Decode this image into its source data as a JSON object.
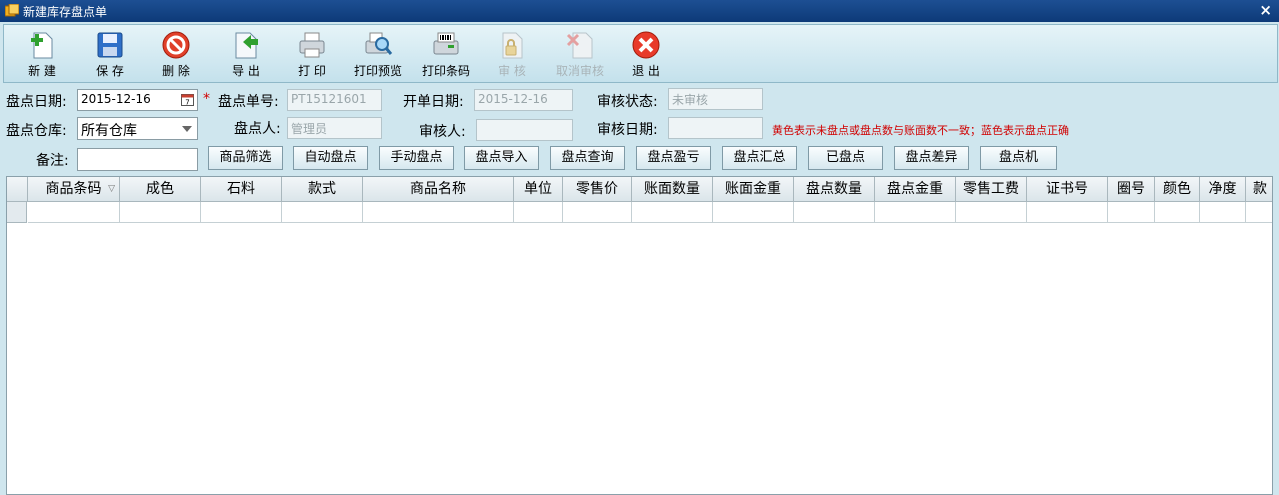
{
  "window": {
    "title": "新建库存盘点单",
    "close": "×"
  },
  "toolbar": [
    {
      "label": "新 建",
      "icon": "new-icon",
      "enabled": true
    },
    {
      "label": "保 存",
      "icon": "save-icon",
      "enabled": true
    },
    {
      "label": "删 除",
      "icon": "delete-icon",
      "enabled": true
    },
    {
      "label": "导 出",
      "icon": "export-icon",
      "enabled": true
    },
    {
      "label": "打 印",
      "icon": "print-icon",
      "enabled": true
    },
    {
      "label": "打印预览",
      "icon": "print-preview-icon",
      "enabled": true
    },
    {
      "label": "打印条码",
      "icon": "print-barcode-icon",
      "enabled": true
    },
    {
      "label": "审 核",
      "icon": "audit-icon",
      "enabled": false
    },
    {
      "label": "取消审核",
      "icon": "cancel-audit-icon",
      "enabled": false
    },
    {
      "label": "退 出",
      "icon": "exit-icon",
      "enabled": true
    }
  ],
  "form": {
    "count_date_label": "盘点日期:",
    "count_date_value": "2015-12-16",
    "required_mark": "*",
    "count_no_label": "盘点单号:",
    "count_no_value": "PT15121601",
    "open_date_label": "开单日期:",
    "open_date_value": "2015-12-16",
    "audit_status_label": "审核状态:",
    "audit_status_value": "未审核",
    "warehouse_label": "盘点仓库:",
    "warehouse_value": "所有仓库",
    "counter_label": "盘点人:",
    "counter_value": "管理员",
    "auditor_label": "审核人:",
    "auditor_value": "",
    "audit_date_label": "审核日期:",
    "audit_date_value": "",
    "hint": "黄色表示未盘点或盘点数与账面数不一致；蓝色表示盘点正确",
    "remark_label": "备注:",
    "remark_value": ""
  },
  "actions": [
    "商品筛选",
    "自动盘点",
    "手动盘点",
    "盘点导入",
    "盘点查询",
    "盘点盈亏",
    "盘点汇总",
    "已盘点",
    "盘点差异",
    "盘点机"
  ],
  "grid": {
    "columns": [
      "商品条码",
      "成色",
      "石料",
      "款式",
      "商品名称",
      "单位",
      "零售价",
      "账面数量",
      "账面金重",
      "盘点数量",
      "盘点金重",
      "零售工费",
      "证书号",
      "圈号",
      "颜色",
      "净度",
      "款"
    ],
    "sort_indicator": "▽"
  }
}
